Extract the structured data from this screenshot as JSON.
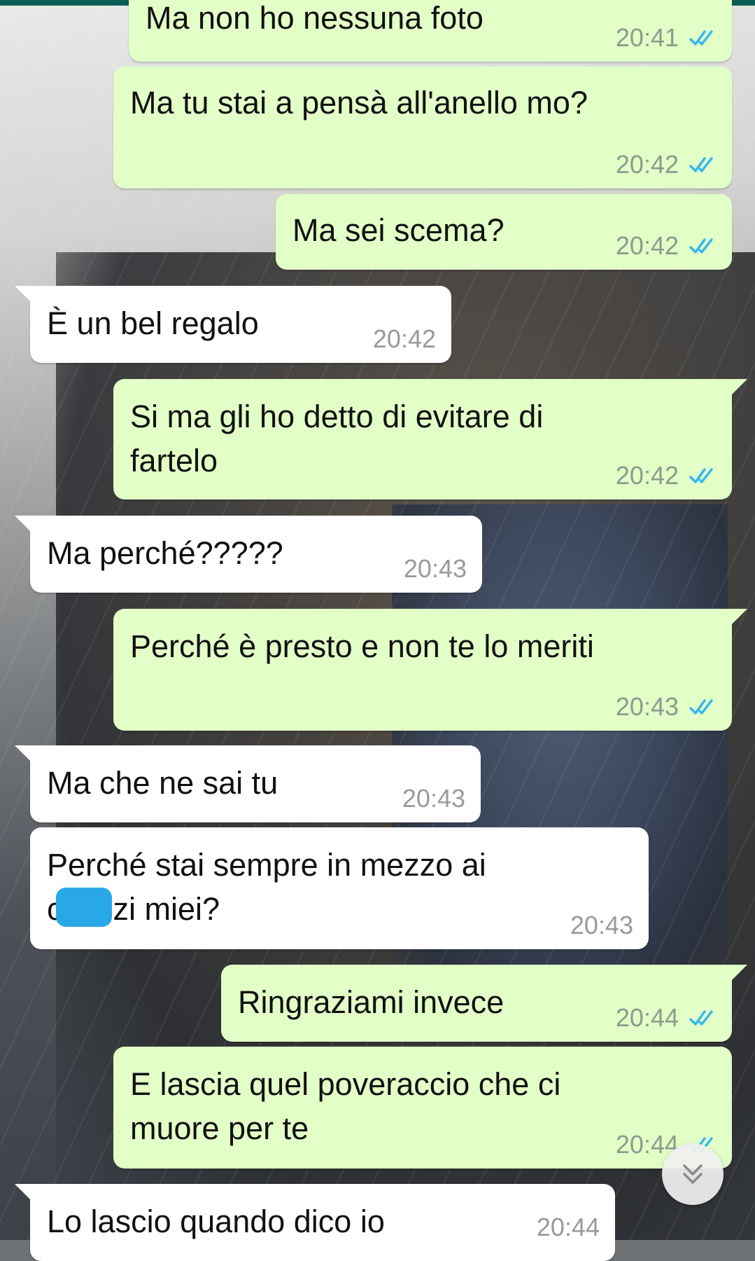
{
  "colors": {
    "outgoing_bubble": "#e2ffc7",
    "incoming_bubble": "#ffffff",
    "read_ticks": "#34b7f1",
    "redaction": "#29a8e8"
  },
  "icons": {
    "read_receipt": "double-check-icon",
    "scroll_down": "chevron-double-down-icon"
  },
  "messages": [
    {
      "direction": "out",
      "text": "Ma non ho nessuna foto",
      "time": "20:41",
      "status": "read"
    },
    {
      "direction": "out",
      "text": "Ma tu stai a pensà all'anello mo?",
      "time": "20:42",
      "status": "read"
    },
    {
      "direction": "out",
      "text": "Ma sei scema?",
      "time": "20:42",
      "status": "read"
    },
    {
      "direction": "in",
      "text": "È un bel regalo",
      "time": "20:42"
    },
    {
      "direction": "out",
      "text": "Si ma gli ho detto di evitare di\nfartelo",
      "time": "20:42",
      "status": "read"
    },
    {
      "direction": "in",
      "text": "Ma perché?????",
      "time": "20:43"
    },
    {
      "direction": "out",
      "text": "Perché è presto e non te lo meriti",
      "time": "20:43",
      "status": "read"
    },
    {
      "direction": "in",
      "text": "Ma che ne sai tu",
      "time": "20:43"
    },
    {
      "direction": "in",
      "text_line1": "Perché stai sempre in mezzo ai",
      "text_line2_start": "c",
      "text_line2_end": "zi miei?",
      "time": "20:43",
      "redacted": true
    },
    {
      "direction": "out",
      "text": "Ringraziami invece",
      "time": "20:44",
      "status": "read"
    },
    {
      "direction": "out",
      "text": "E lascia quel poveraccio che ci\nmuore per te",
      "time": "20:44",
      "status": "read"
    },
    {
      "direction": "in",
      "text": "Lo lascio quando dico io",
      "time": "20:44"
    }
  ]
}
